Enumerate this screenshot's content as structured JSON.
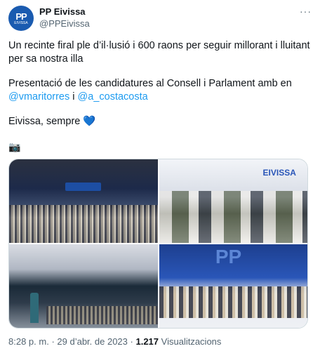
{
  "account": {
    "display_name": "PP Eivissa",
    "handle": "@PPEivissa",
    "avatar_text": "PP",
    "avatar_subtext": "EIVISSA"
  },
  "more_label": "···",
  "tweet": {
    "line1": "Un recinte firal ple d’il·lusió i 600 raons per seguir millorant i lluitant per sa nostra illa",
    "line2_text": "Presentació de les candidatures al Consell i Parlament amb en",
    "mention1": "@vmaritorres",
    "connector": "i",
    "mention2": "@a_costacosta",
    "line3_text": "Eivissa, sempre",
    "heart": "💙",
    "camera": "📷"
  },
  "media": {
    "photo2_logo": "EIVISSA",
    "photo4_logo": "PP"
  },
  "footer": {
    "time": "8:28 p. m.",
    "sep1": "·",
    "date": "29 d’abr. de 2023",
    "sep2": "·",
    "views_count": "1.217",
    "views_label": "Visualitzacions"
  }
}
